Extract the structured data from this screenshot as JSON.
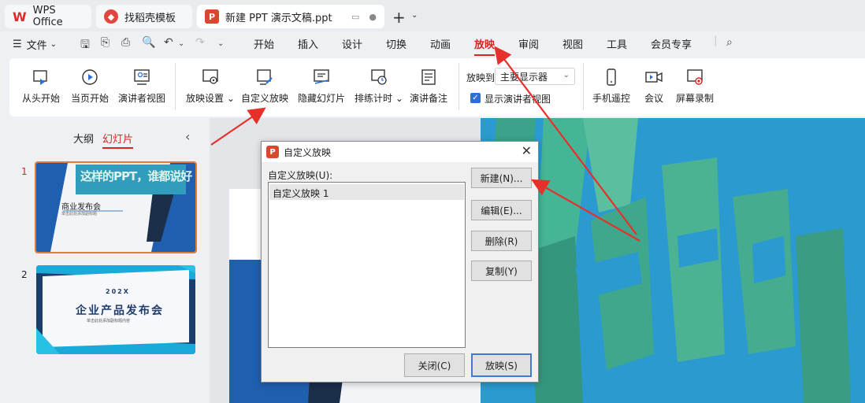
{
  "tabs": [
    {
      "label": "WPS Office",
      "icon": "wps-logo-icon"
    },
    {
      "label": "找稻壳模板",
      "icon": "docer-icon"
    },
    {
      "label": "新建 PPT 演示文稿.ppt",
      "icon": "ppt-file-icon"
    }
  ],
  "menu": {
    "file_label": "文件",
    "tabs": [
      "开始",
      "插入",
      "设计",
      "切换",
      "动画",
      "放映",
      "审阅",
      "视图",
      "工具",
      "会员专享"
    ],
    "active_tab": "放映"
  },
  "ribbon": {
    "buttons": [
      {
        "label": "从头开始",
        "icon": "play-from-start-icon"
      },
      {
        "label": "当页开始",
        "icon": "play-current-icon"
      },
      {
        "label": "演讲者视图",
        "icon": "presenter-view-icon"
      },
      {
        "label": "放映设置",
        "icon": "slideshow-settings-icon"
      },
      {
        "label": "自定义放映",
        "icon": "custom-show-icon"
      },
      {
        "label": "隐藏幻灯片",
        "icon": "hide-slide-icon"
      },
      {
        "label": "排练计时",
        "icon": "rehearse-timing-icon"
      },
      {
        "label": "演讲备注",
        "icon": "speaker-notes-icon"
      },
      {
        "label": "手机遥控",
        "icon": "phone-remote-icon"
      },
      {
        "label": "会议",
        "icon": "meeting-icon"
      },
      {
        "label": "屏幕录制",
        "icon": "screen-record-icon"
      }
    ],
    "show_on_label": "放映到",
    "show_on_value": "主要显示器",
    "presenter_checkbox_label": "显示演讲者视图"
  },
  "left_panel": {
    "tab_outline": "大纲",
    "tab_slides": "幻灯片",
    "slides": [
      {
        "number": "1",
        "title": "商业发布会",
        "subtitle": "单击此处添加副标题",
        "banner": "这样的PPT，谁都说好"
      },
      {
        "number": "2",
        "year": "202X",
        "title": "企业产品发布会",
        "subtitle": "单击此处添加副标题内容"
      }
    ]
  },
  "dialog": {
    "title": "自定义放映",
    "list_label": "自定义放映(U):",
    "list_items": [
      "自定义放映 1"
    ],
    "buttons": {
      "new": "新建(N)...",
      "edit": "编辑(E)...",
      "delete": "删除(R)",
      "copy": "复制(Y)",
      "close": "关闭(C)",
      "show": "放映(S)"
    }
  },
  "colors": {
    "accent": "#d3271f",
    "slide_blue": "#2a9ad0",
    "slide_green": "#3aa38a",
    "dialog_primary": "#3a7bd5"
  }
}
